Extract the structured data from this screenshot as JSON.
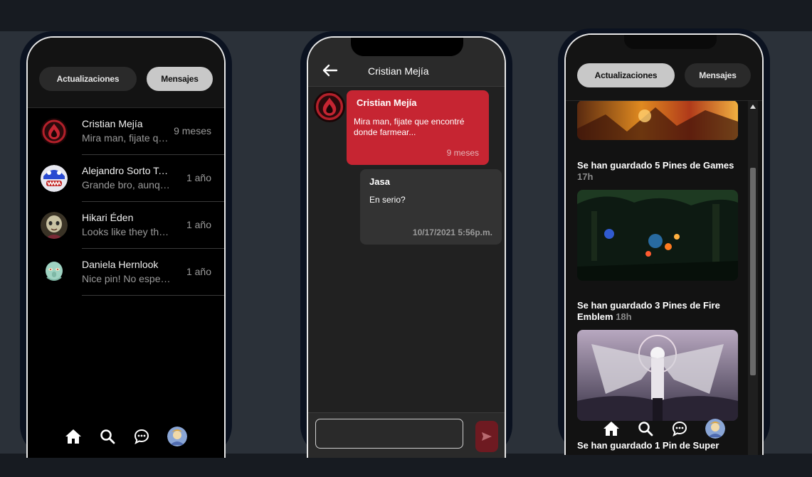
{
  "screens": {
    "messages_list": {
      "tabs": [
        {
          "label": "Actualizaciones",
          "active": false
        },
        {
          "label": "Mensajes",
          "active": true
        }
      ],
      "conversations": [
        {
          "name": "Cristian Mejía",
          "preview": "Mira man, fijate que encontré donde farmear...",
          "time": "9 meses",
          "avatar_icon": "red-emblem-avatar-icon"
        },
        {
          "name": "Alejandro Sorto Toledo",
          "preview": "Grande bro, aunque...",
          "time": "1 año",
          "avatar_icon": "blue-mascot-avatar-icon"
        },
        {
          "name": "Hikari Éden",
          "preview": "Looks like they this...",
          "time": "1 año",
          "avatar_icon": "character-avatar-icon"
        },
        {
          "name": "Daniela Hernlook",
          "preview": "Nice pin! No esperaba...",
          "time": "1 año",
          "avatar_icon": "squid-avatar-icon"
        }
      ],
      "navbar": [
        "home-icon",
        "search-icon",
        "messages-icon",
        "profile-avatar"
      ]
    },
    "chat": {
      "title": "Cristian Mejía",
      "messages": [
        {
          "author": "Cristian Mejía",
          "text": "Mira man, fijate que encontré donde farmear...",
          "time": "9 meses",
          "color": "#c62532"
        },
        {
          "author": "Jasa",
          "text": "En serio?",
          "time": "10/17/2021  5:56p.m.",
          "color": "#333333"
        }
      ],
      "input": {
        "value": "",
        "placeholder": ""
      }
    },
    "updates": {
      "tabs": [
        {
          "label": "Actualizaciones",
          "active": true
        },
        {
          "label": "Mensajes",
          "active": false
        }
      ],
      "feed": [
        {
          "title": "Se han guardado 5 Pines de Games",
          "age": "17h"
        },
        {
          "title": "Se han guardado 3 Pines de Fire Emblem",
          "age": "18h"
        },
        {
          "title": "Se han guardado 1 Pin de Super",
          "age": ""
        }
      ]
    }
  },
  "colors": {
    "accent_red": "#c62532",
    "send_button": "#6e1a21",
    "background": "#2b3139"
  }
}
